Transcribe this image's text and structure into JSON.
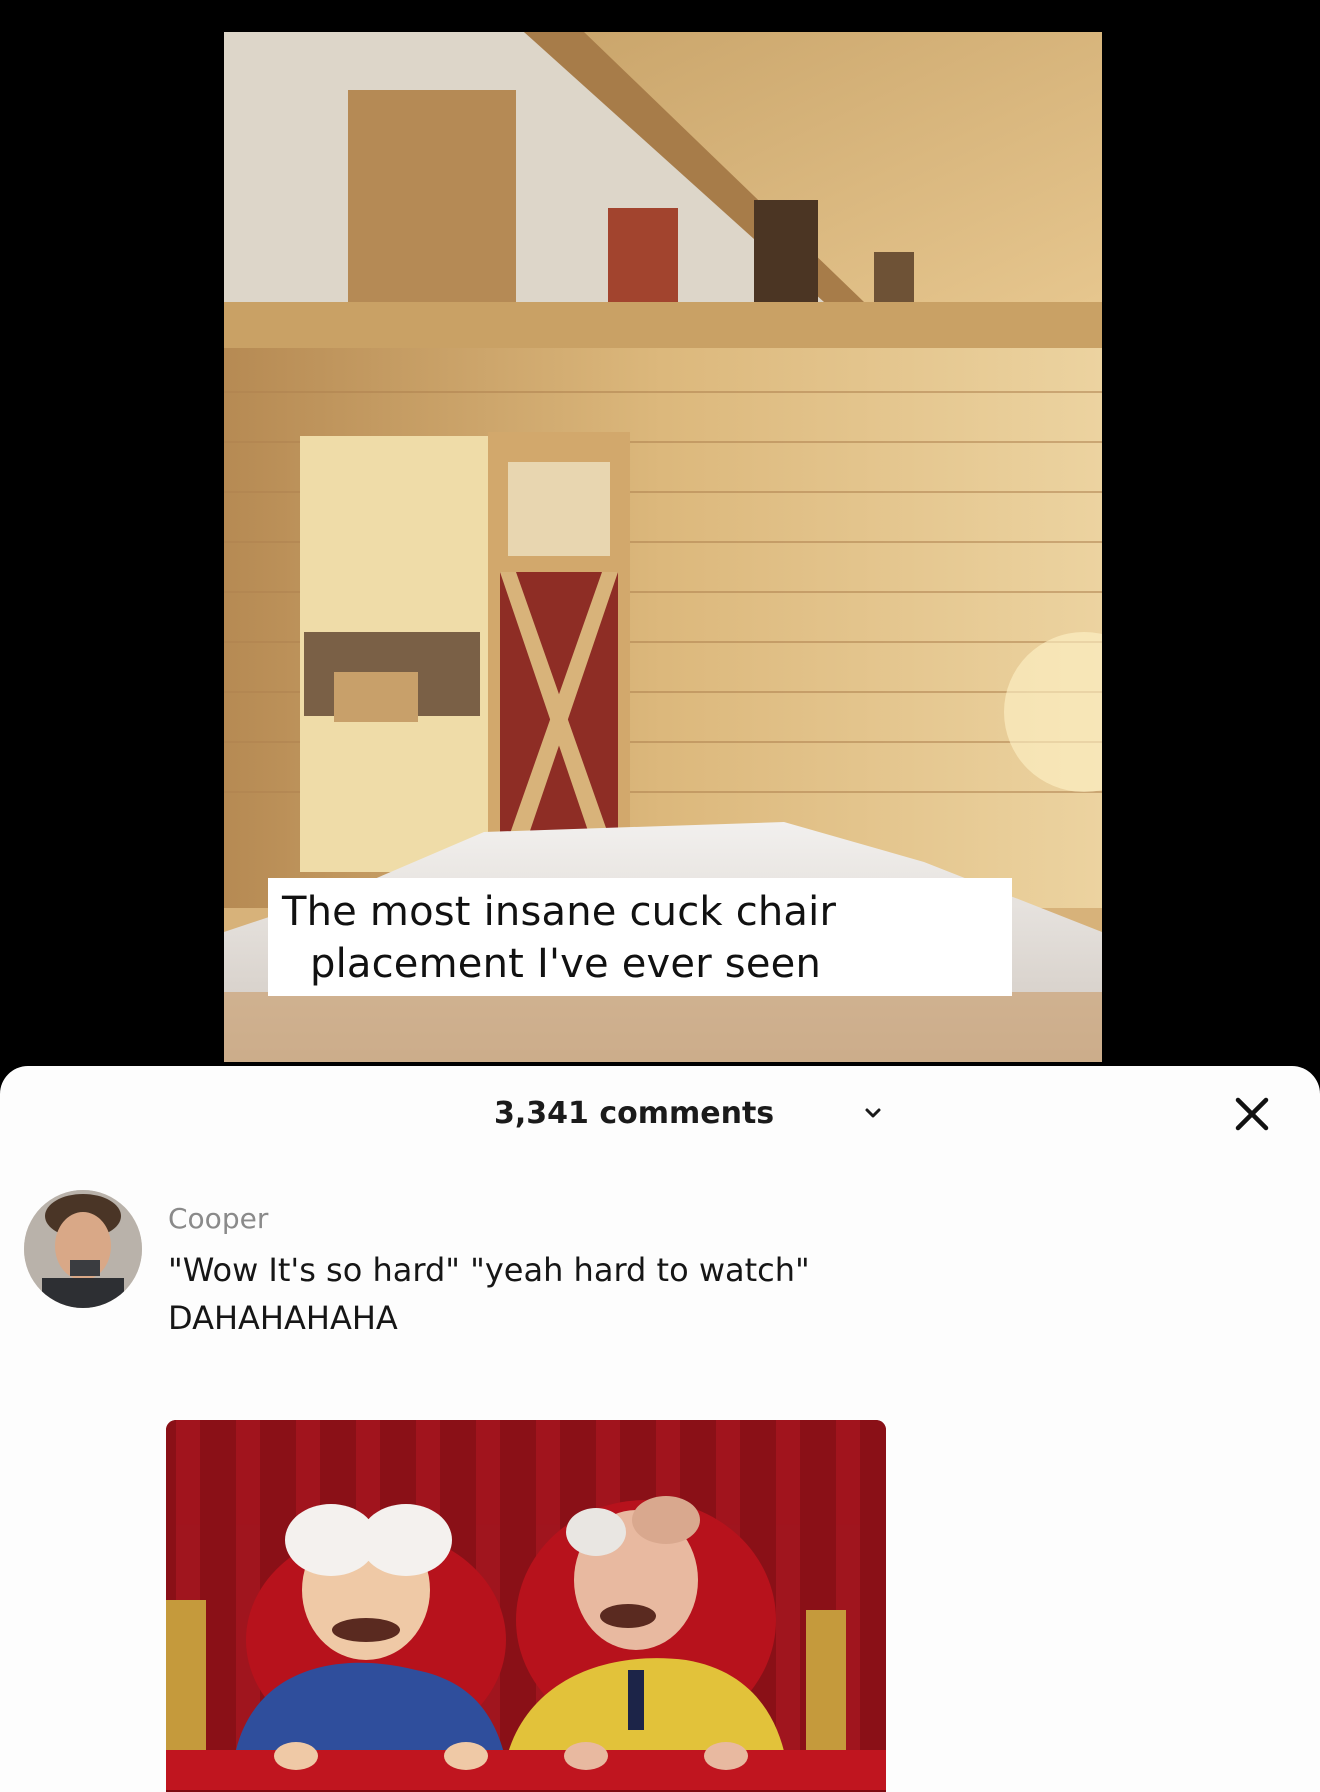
{
  "post": {
    "caption_line1": "The most insane cuck chair",
    "caption_line2": "placement I've ever seen"
  },
  "comments": {
    "count_label": "3,341 comments",
    "items": [
      {
        "author": "Cooper",
        "text_line1": "\"Wow It's so hard\" \"yeah hard to watch\"",
        "text_line2": "DAHAHAHAHA",
        "has_image": true
      }
    ]
  },
  "icons": {
    "count_toggle": "chevron-down-icon",
    "close": "close-icon"
  },
  "colors": {
    "sheet_background": "#fdfdfd",
    "author_gray": "#8a8a8a",
    "text_dark": "#161616"
  }
}
